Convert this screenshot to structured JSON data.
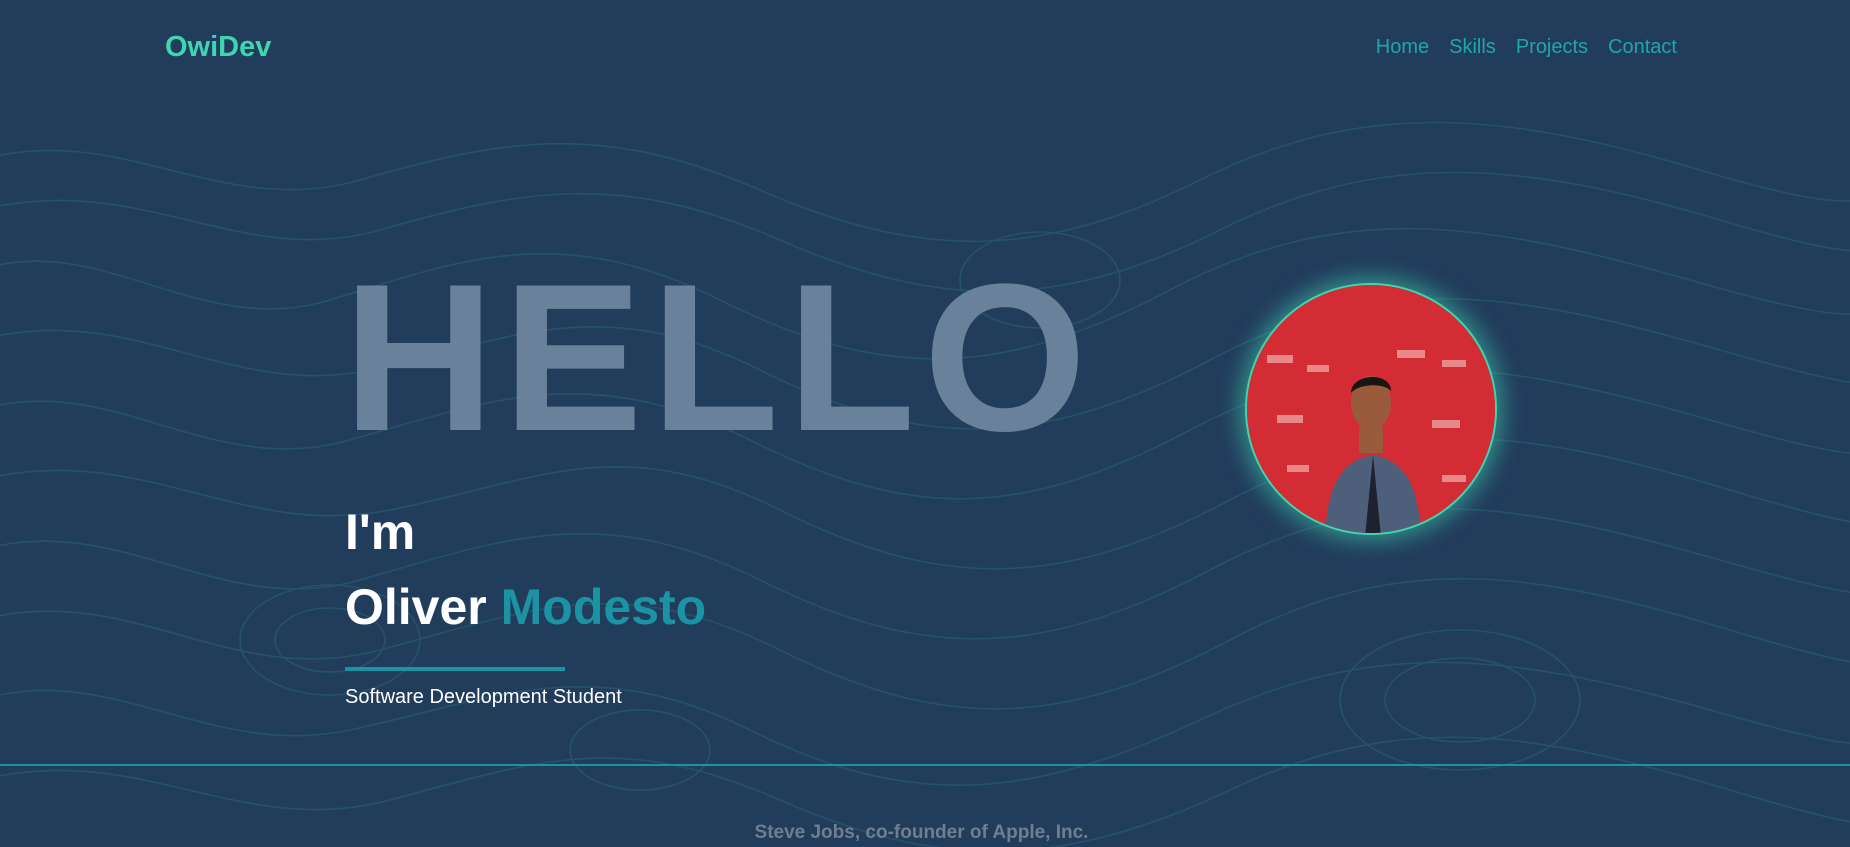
{
  "navbar": {
    "brand": "OwiDev",
    "links": [
      "Home",
      "Skills",
      "Projects",
      "Contact"
    ]
  },
  "hero": {
    "greeting": "HELLO",
    "intro": "I'm",
    "first_name": "Oliver",
    "last_name": "Modesto",
    "role": "Software Development Student"
  },
  "quote": {
    "author": "Steve Jobs, co-founder of Apple, Inc."
  },
  "colors": {
    "background": "#223c5c",
    "brand": "#3ed6b0",
    "accent": "#1b93a3",
    "hello_text": "#7189a1",
    "avatar_backdrop": "#d42c34"
  },
  "icons": {
    "avatar": "profile-photo"
  }
}
